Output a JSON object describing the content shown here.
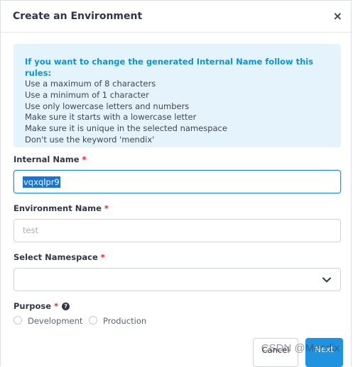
{
  "dialog": {
    "title": "Create an Environment",
    "close_label": "×"
  },
  "info_box": {
    "heading": "If you want to change the generated Internal Name follow this rules:",
    "rules": [
      "Use a maximum of 8 characters",
      "Use a minimum of 1 character",
      "Use only lowercase letters and numbers",
      "Make sure it starts with a lowercase letter",
      "Make sure it is unique in the selected namespace",
      "Don't use the keyword 'mendix'"
    ]
  },
  "fields": {
    "internal_name": {
      "label": "Internal Name",
      "required": "*",
      "value": "vqxqlpr9"
    },
    "environment_name": {
      "label": "Environment Name",
      "required": "*",
      "placeholder": "test"
    },
    "namespace": {
      "label": "Select Namespace",
      "required": "*",
      "value": ""
    },
    "purpose": {
      "label": "Purpose",
      "required": "*",
      "help_icon": "?",
      "options": [
        "Development",
        "Production"
      ]
    }
  },
  "buttons": {
    "cancel": "Cancel",
    "next": "Next"
  },
  "watermark": "CSDN @Mendix",
  "colors": {
    "accent": "#1f92e0",
    "info_bg": "#e5f3fd",
    "info_heading": "#0595db",
    "required": "#e32929"
  }
}
